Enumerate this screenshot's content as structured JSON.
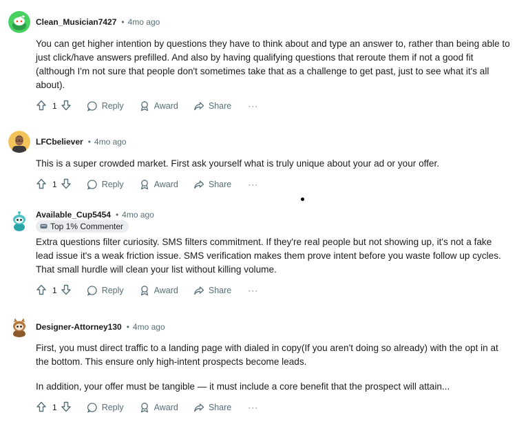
{
  "comments": [
    {
      "author": "Clean_Musician7427",
      "time": "4mo ago",
      "avatar": "snoo-avatar-green",
      "body": [
        "You can get higher intention by questions they have to think about and type an answer to, rather than being able to just click/have answers prefilled. And also by having qualifying questions that reroute them if not a good fit (although I'm not sure that people don't sometimes take that as a challenge to get past, just to see what it's all about)."
      ],
      "votes": "1"
    },
    {
      "author": "LFCbeliever",
      "time": "4mo ago",
      "avatar": "photo-avatar-man",
      "body": [
        "This is a super crowded market. First ask yourself what is truly unique about your ad or your offer."
      ],
      "votes": "1"
    },
    {
      "author": "Available_Cup5454",
      "time": "4mo ago",
      "avatar": "snoo-avatar-teal",
      "flair": "Top 1% Commenter",
      "body": [
        "Extra questions filter curiosity. SMS filters commitment. If they're real people but not showing up, it's not a fake lead issue it's a weak friction issue. SMS verification makes them prove intent before you waste follow up cycles. That small hurdle will clean your list without killing volume."
      ],
      "votes": "1"
    },
    {
      "author": "Designer-Attorney130",
      "time": "4mo ago",
      "avatar": "snoo-avatar-brown",
      "body": [
        "First, you must direct traffic to a landing page with dialed in copy(If you aren't doing so already) with the opt in at the bottom. This ensure only high-intent prospects become leads.",
        "In addition, your offer must be tangible — it must include a core benefit that the prospect will attain..."
      ],
      "votes": "1"
    }
  ],
  "actions": {
    "reply": "Reply",
    "award": "Award",
    "share": "Share",
    "more": "···"
  },
  "separator": "•",
  "colors": {
    "meta": "#576f76",
    "text": "#1c1c1c",
    "flair_bg": "#eaedef"
  }
}
